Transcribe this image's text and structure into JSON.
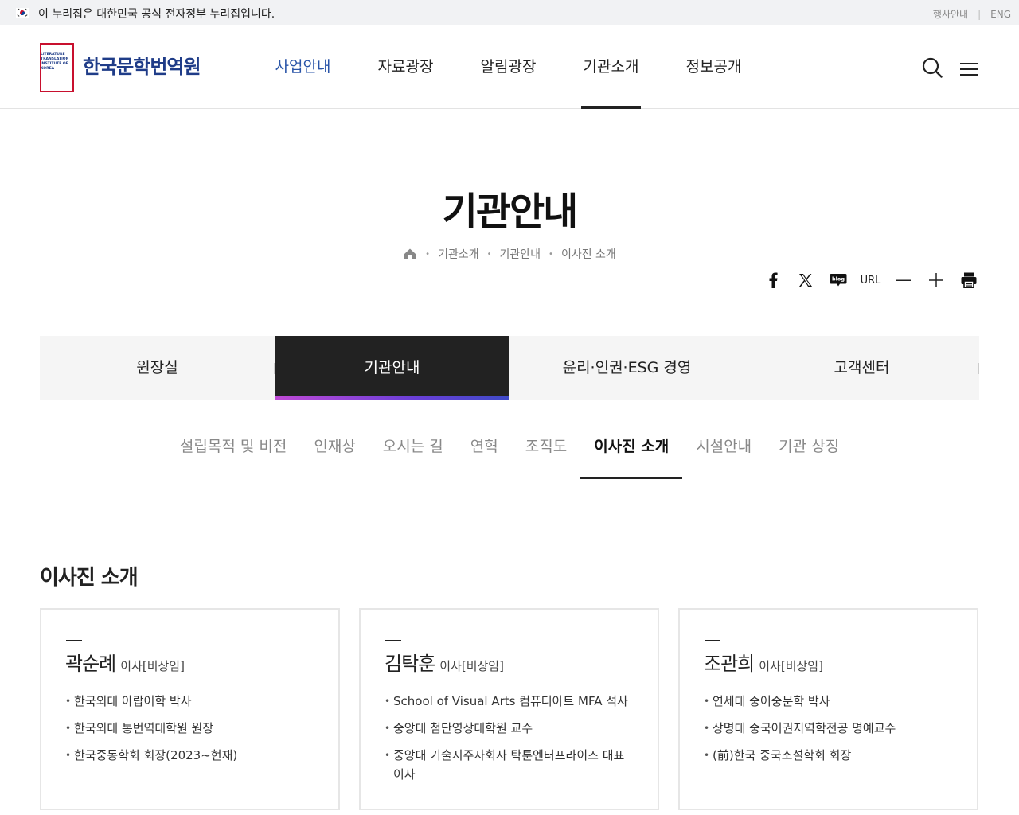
{
  "gov_bar": {
    "notice": "이 누리집은 대한민국 공식 전자정부 누리집입니다.",
    "links": [
      "행사안내",
      "ENG"
    ]
  },
  "header": {
    "logo_en_lines": [
      "LITERATURE",
      "TRANSLATION",
      "INSTITUTE OF",
      "KOREA"
    ],
    "logo_name": "한국문학번역원",
    "nav": [
      "사업안내",
      "자료광장",
      "알림광장",
      "기관소개",
      "정보공개"
    ]
  },
  "page": {
    "title": "기관안내",
    "breadcrumb": [
      "기관소개",
      "기관안내",
      "이사진 소개"
    ]
  },
  "tools": {
    "url_label": "URL",
    "blog_label": "blog"
  },
  "depth2": [
    "원장실",
    "기관안내",
    "윤리·인권·ESG 경영",
    "고객센터"
  ],
  "depth3": [
    "설립목적 및 비전",
    "인재상",
    "오시는 길",
    "연혁",
    "조직도",
    "이사진 소개",
    "시설안내",
    "기관 상징"
  ],
  "section": {
    "title": "이사진 소개",
    "members": [
      {
        "name": "곽순례",
        "role": "이사[비상임]",
        "items": [
          "한국외대 아랍어학 박사",
          "한국외대 통번역대학원 원장",
          "한국중동학회 회장(2023~현재)"
        ]
      },
      {
        "name": "김탁훈",
        "role": "이사[비상임]",
        "items": [
          "School of Visual Arts 컴퓨터아트 MFA 석사",
          "중앙대 첨단영상대학원 교수",
          "중앙대 기술지주자회사 탁툰엔터프라이즈 대표이사"
        ]
      },
      {
        "name": "조관희",
        "role": "이사[비상임]",
        "items": [
          "연세대 중어중문학 박사",
          "상명대 중국어권지역학전공 명예교수",
          "(前)한국 중국소설학회 회장"
        ]
      }
    ]
  },
  "colors": {
    "brand_blue": "#1f3c88",
    "brand_red": "#c8102e",
    "nav_active_blue": "#2a55a8",
    "tab_active_bg": "#222222"
  }
}
